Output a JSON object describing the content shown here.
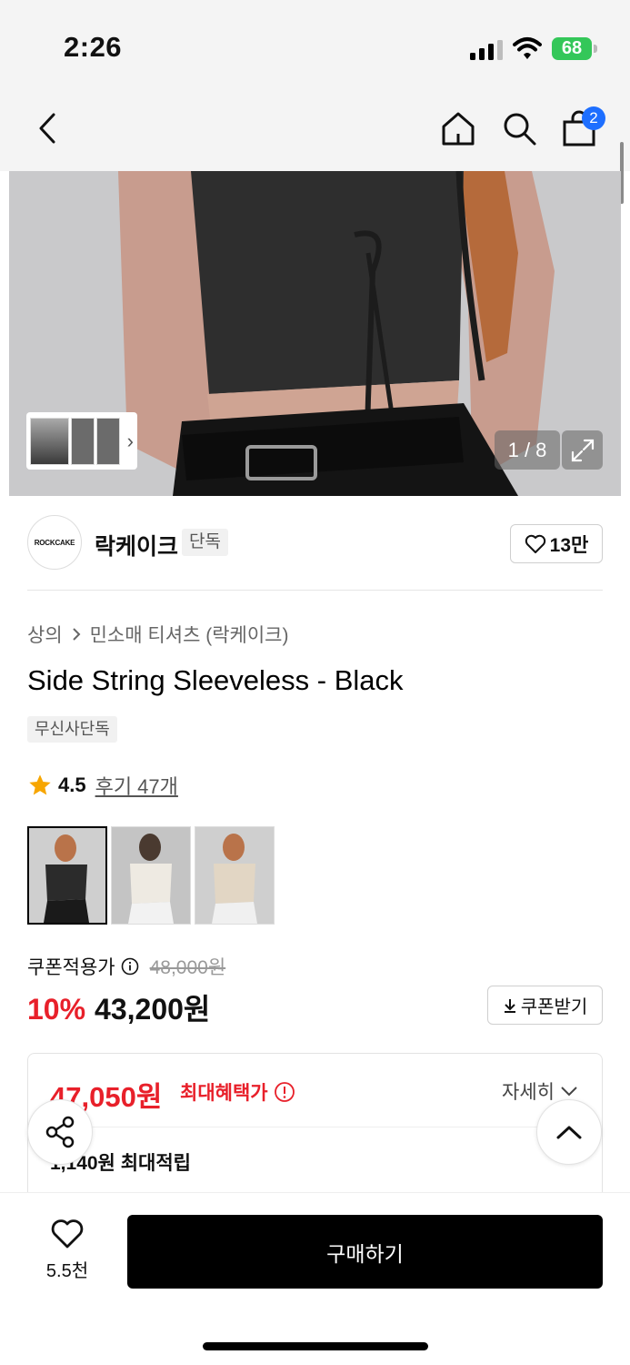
{
  "status": {
    "time": "2:26",
    "battery": "68"
  },
  "nav": {
    "cart_count": "2",
    "icons": [
      "chevron-left-icon",
      "home-icon",
      "search-icon",
      "shopping-bag-icon"
    ]
  },
  "gallery": {
    "counter": "1 / 8",
    "thumb_arrow": "›"
  },
  "brand": {
    "logo_text": "ROCKCAKE",
    "name": "락케이크",
    "tag": "단독",
    "likes": "13만"
  },
  "product": {
    "breadcrumb": [
      "상의",
      "민소매 티셔츠 (락케이크)"
    ],
    "title": "Side String Sleeveless - Black",
    "exclusive_badge": "무신사단독",
    "rating": "4.5",
    "reviews": "후기 47개"
  },
  "price": {
    "label": "쿠폰적용가",
    "original": "48,000원",
    "discount": "10%",
    "final": "43,200원",
    "coupon_button": "쿠폰받기"
  },
  "benefit": {
    "max_price": "47,050원",
    "max_label": "최대혜택가",
    "detail": "자세히",
    "points": "1,140원 최대적립"
  },
  "bottom": {
    "wish_count": "5.5천",
    "buy_label": "구매하기"
  },
  "colors": {
    "accent_red": "#e8202a",
    "badge_blue": "#1e6fff",
    "battery_green": "#34c759"
  }
}
